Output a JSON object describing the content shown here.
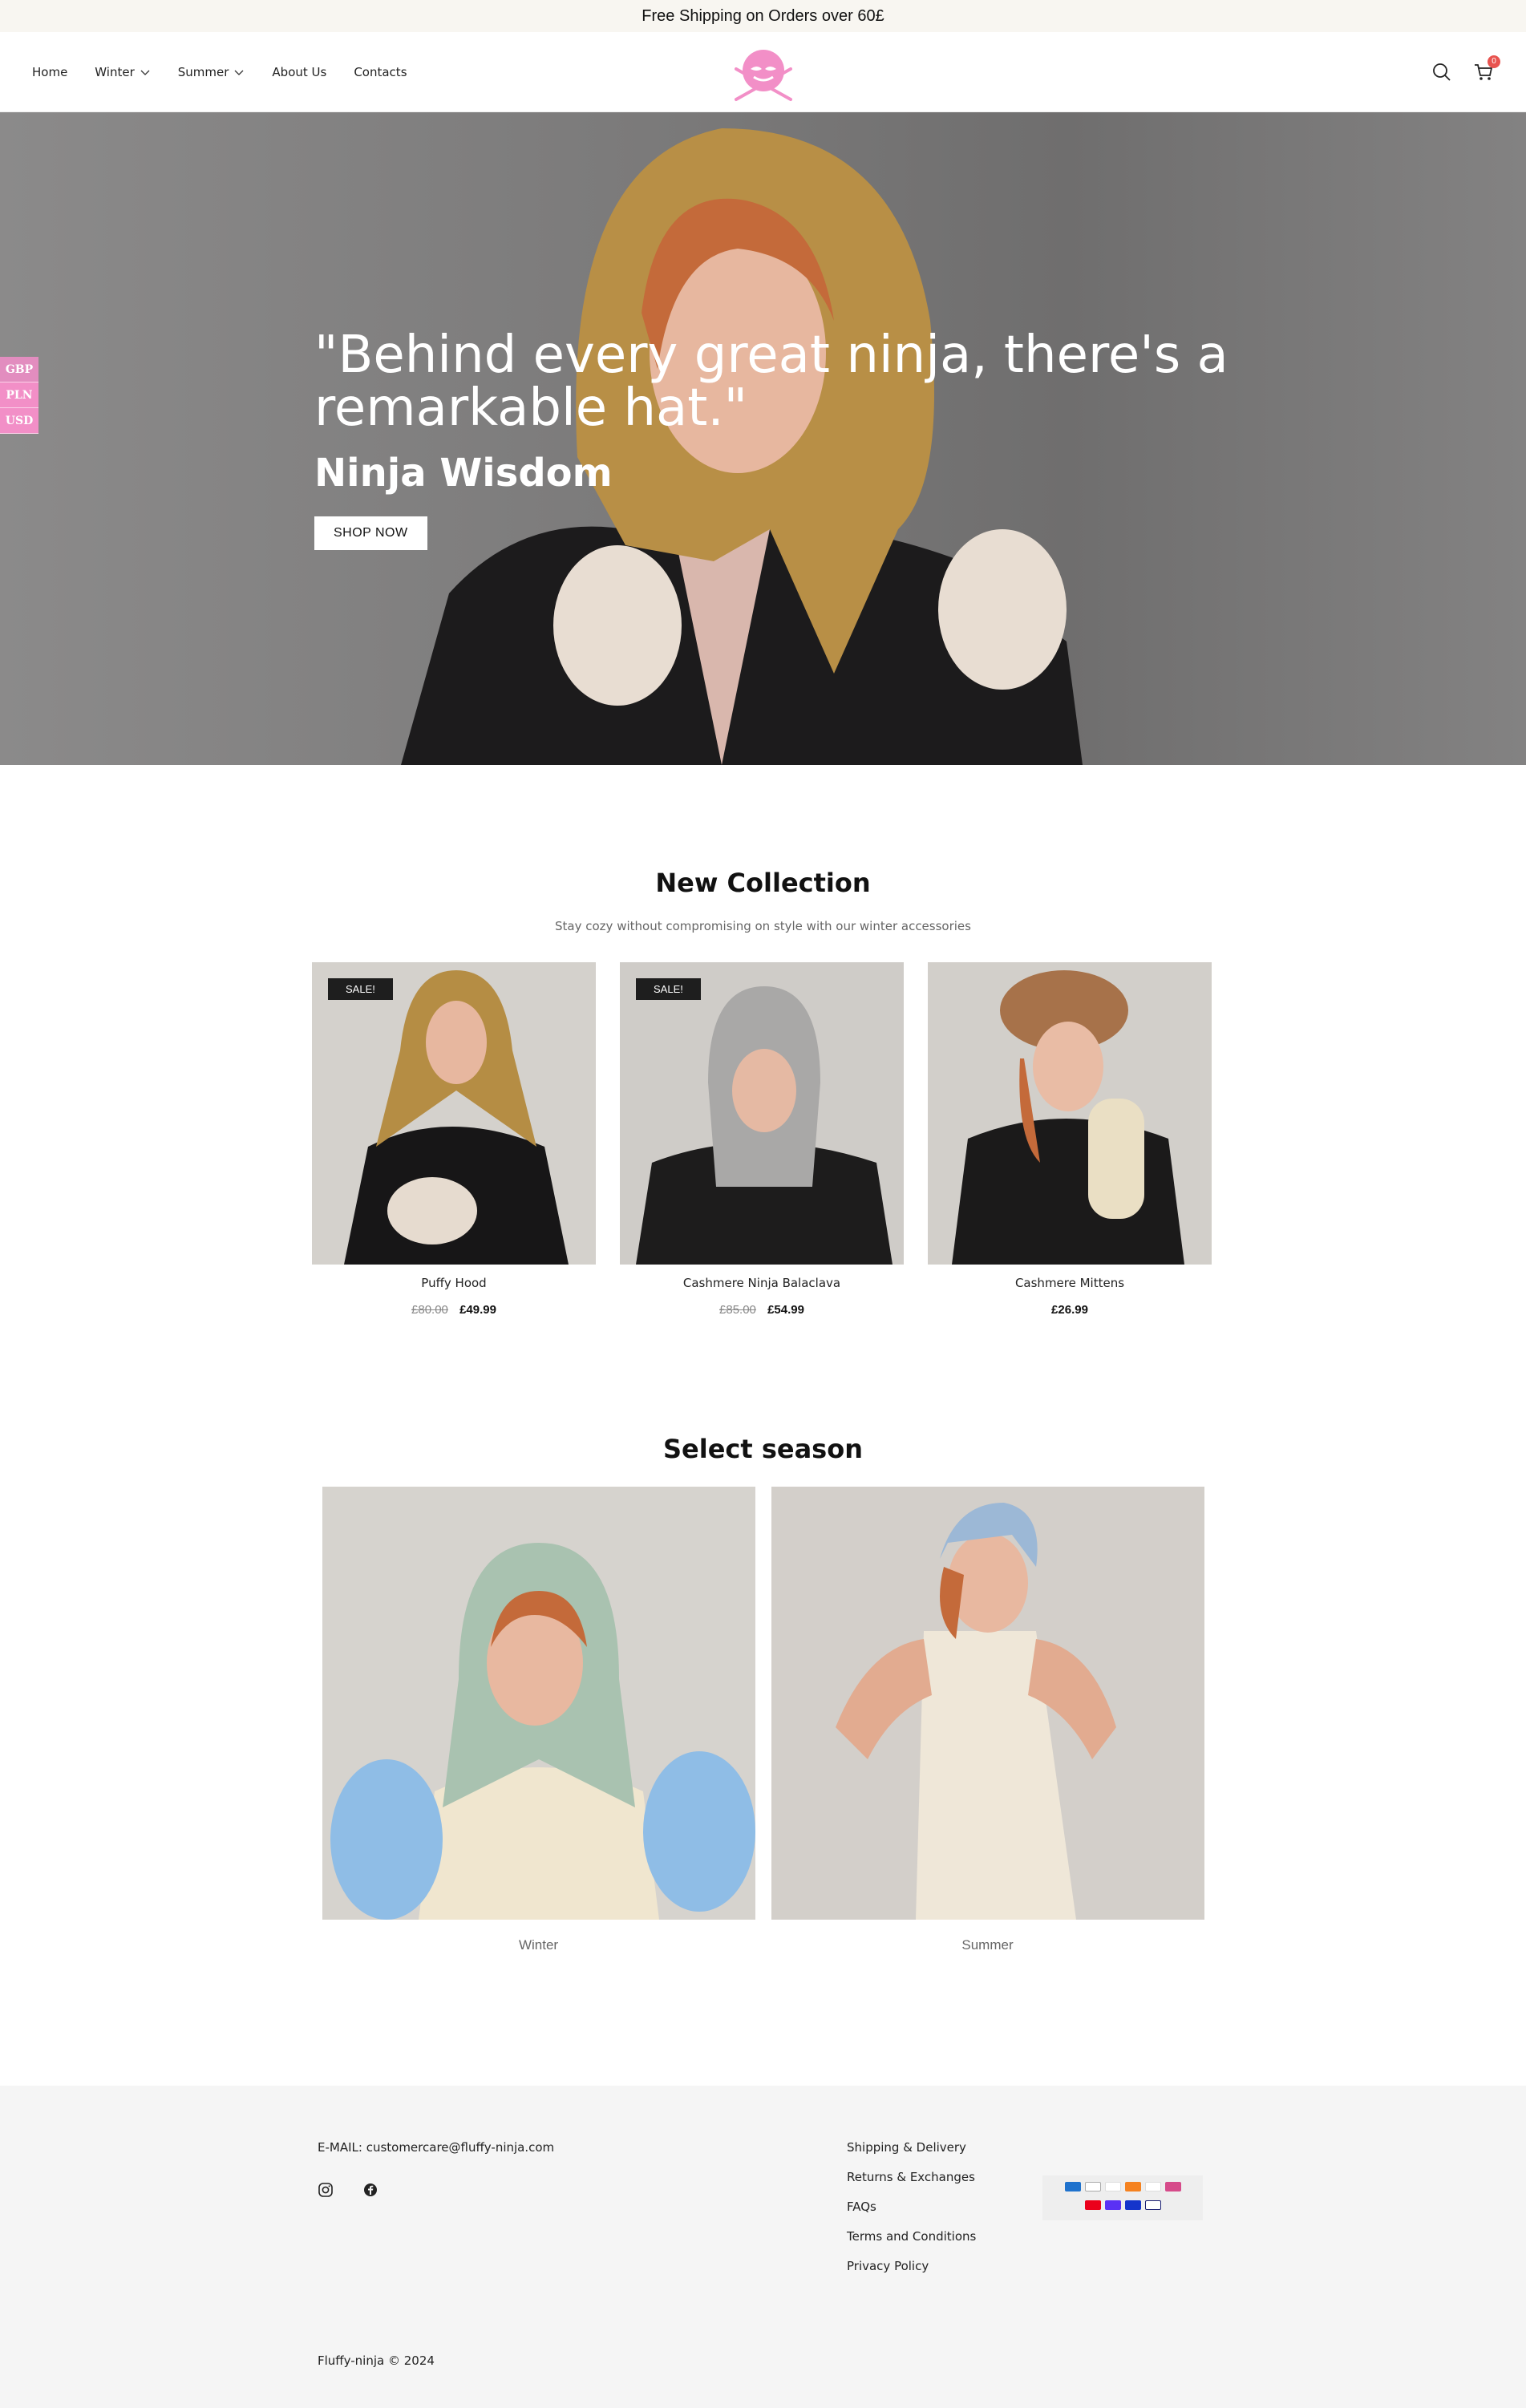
{
  "announcement": "Free Shipping on Orders over 60£",
  "nav": [
    {
      "label": "Home"
    },
    {
      "label": "Winter"
    },
    {
      "label": "Summer"
    },
    {
      "label": "About Us"
    },
    {
      "label": "Contacts"
    }
  ],
  "cart_count": "0",
  "currency": [
    "GBP",
    "PLN",
    "USD"
  ],
  "hero": {
    "quote": "\"Behind every great ninja, there's a remarkable hat.\"",
    "subtitle": "Ninja Wisdom",
    "button": "SHOP NOW"
  },
  "collection": {
    "title": "New Collection",
    "subtitle": "Stay cozy without compromising on style with our winter accessories",
    "products": [
      {
        "name": "Puffy Hood",
        "badge": "SALE!",
        "old_price": "£80.00",
        "price": "£49.99"
      },
      {
        "name": "Cashmere Ninja Balaclava",
        "badge": "SALE!",
        "old_price": "£85.00",
        "price": "£54.99"
      },
      {
        "name": "Cashmere Mittens",
        "badge": "",
        "old_price": "",
        "price": "£26.99"
      }
    ]
  },
  "seasons": {
    "title": "Select season",
    "items": [
      {
        "label": "Winter"
      },
      {
        "label": "Summer"
      }
    ]
  },
  "footer": {
    "email": "E-MAIL: customercare@fluffy-ninja.com",
    "links": [
      "Shipping & Delivery",
      "Returns & Exchanges",
      "FAQs",
      "Terms and Conditions",
      "Privacy Policy"
    ],
    "copyright": "Fluffy-ninja © 2024"
  },
  "colors": {
    "brand_pink": "#f28fc7",
    "sale_badge": "#1e1e1e",
    "cart_badge": "#e8534f",
    "announcement_bg": "#f8f6f1",
    "footer_bg": "#f5f5f5"
  }
}
